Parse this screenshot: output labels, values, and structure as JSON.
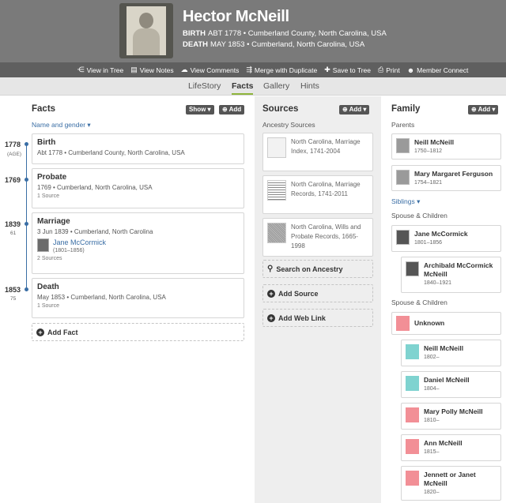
{
  "person": {
    "name": "Hector McNeill",
    "birth_label": "BIRTH",
    "birth_value": "ABT 1778 • Cumberland County, North Carolina, USA",
    "death_label": "DEATH",
    "death_value": "MAY 1853 • Cumberland, North Carolina, USA"
  },
  "toolbar": {
    "view_tree": "View in Tree",
    "view_notes": "View Notes",
    "view_comments": "View Comments",
    "merge": "Merge with Duplicate",
    "save_tree": "Save to Tree",
    "print": "Print",
    "member_connect": "Member Connect"
  },
  "tabs": {
    "lifestory": "LifeStory",
    "facts": "Facts",
    "gallery": "Gallery",
    "hints": "Hints"
  },
  "facts": {
    "title": "Facts",
    "show_label": "Show ▾",
    "add_label": "Add",
    "name_gender": "Name and gender ▾",
    "age_label": "(AGE)",
    "timeline": [
      {
        "year": "1778",
        "age": ""
      },
      {
        "year": "1769",
        "age": ""
      },
      {
        "year": "1839",
        "age": "61"
      },
      {
        "year": "1853",
        "age": "75"
      }
    ],
    "items": [
      {
        "title": "Birth",
        "detail": "Abt 1778 • Cumberland County, North Carolina, USA",
        "sources": ""
      },
      {
        "title": "Probate",
        "detail": "1769 • Cumberland, North Carolina, USA",
        "sources": "1 Source"
      },
      {
        "title": "Marriage",
        "detail": "3 Jun 1839 • Cumberland, North Carolina",
        "sources": "2 Sources",
        "spouse_name": "Jane McCormick",
        "spouse_dates": "(1801–1856)"
      },
      {
        "title": "Death",
        "detail": "May 1853 • Cumberland, North Carolina, USA",
        "sources": "1 Source"
      }
    ],
    "add_fact": "Add Fact"
  },
  "sources": {
    "title": "Sources",
    "add_label": "Add ▾",
    "ancestry_label": "Ancestry Sources",
    "items": [
      "North Carolina, Marriage Index, 1741-2004",
      "North Carolina, Marriage Records, 1741-2011",
      "North Carolina, Wills and Probate Records, 1665-1998"
    ],
    "search": "Search on Ancestry",
    "add_source": "Add Source",
    "add_web_link": "Add Web Link"
  },
  "family": {
    "title": "Family",
    "add_label": "Add ▾",
    "parents_label": "Parents",
    "parents": [
      {
        "name": "Neill McNeill",
        "dates": "1750–1812"
      },
      {
        "name": "Mary Margaret Ferguson",
        "dates": "1754–1821"
      }
    ],
    "siblings_label": "Siblings ▾",
    "spouse_children_label": "Spouse & Children",
    "spouse1": {
      "name": "Jane McCormick",
      "dates": "1801–1856"
    },
    "child1": {
      "name": "Archibald McCormick McNeill",
      "dates": "1840–1921"
    },
    "spouse_children_label2": "Spouse & Children",
    "spouse2": {
      "name": "Unknown",
      "dates": ""
    },
    "children2": [
      {
        "name": "Neill McNeill",
        "dates": "1802–"
      },
      {
        "name": "Daniel McNeill",
        "dates": "1804–"
      },
      {
        "name": "Mary Polly McNeill",
        "dates": "1810–"
      },
      {
        "name": "Ann McNeill",
        "dates": "1815–"
      },
      {
        "name": "Jennett or Janet McNeill",
        "dates": "1820–"
      }
    ]
  }
}
